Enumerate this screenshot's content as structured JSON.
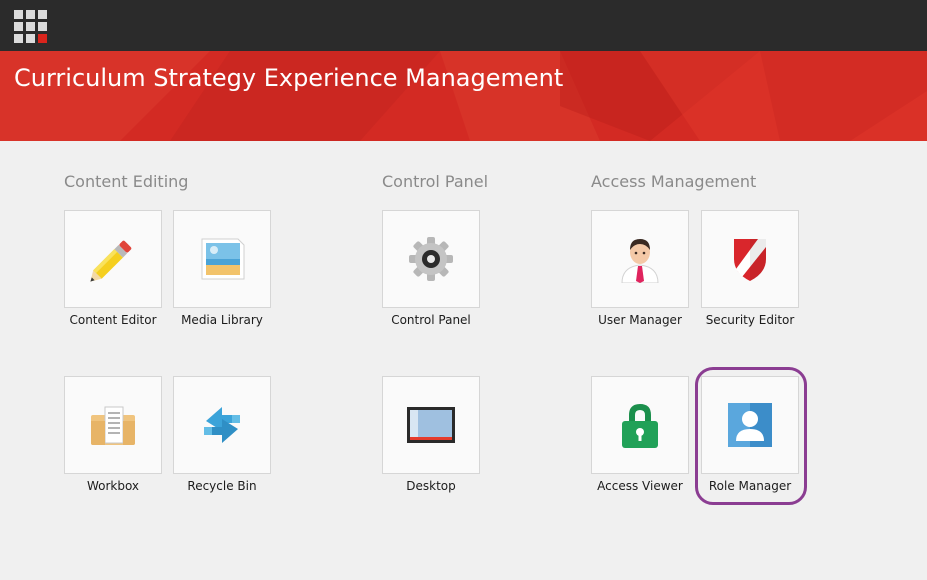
{
  "app": {
    "title": "Curriculum Strategy Experience Management"
  },
  "colors": {
    "topbar": "#2b2b2b",
    "banner": "#d32a23",
    "background": "#f0f0f0",
    "highlight": "#8b3d92"
  },
  "groups": [
    {
      "title": "Content Editing",
      "tiles": [
        {
          "label": "Content Editor",
          "icon": "pencil-icon"
        },
        {
          "label": "Media Library",
          "icon": "image-icon"
        },
        {
          "label": "Workbox",
          "icon": "folder-document-icon"
        },
        {
          "label": "Recycle Bin",
          "icon": "recycle-arrows-icon"
        }
      ]
    },
    {
      "title": "Control Panel",
      "tiles": [
        {
          "label": "Control Panel",
          "icon": "gear-icon"
        },
        {
          "label": "Desktop",
          "icon": "desktop-screen-icon"
        }
      ]
    },
    {
      "title": "Access Management",
      "tiles": [
        {
          "label": "User Manager",
          "icon": "user-icon"
        },
        {
          "label": "Security Editor",
          "icon": "shield-icon"
        },
        {
          "label": "Access Viewer",
          "icon": "padlock-icon"
        },
        {
          "label": "Role Manager",
          "icon": "role-person-icon"
        }
      ]
    }
  ]
}
